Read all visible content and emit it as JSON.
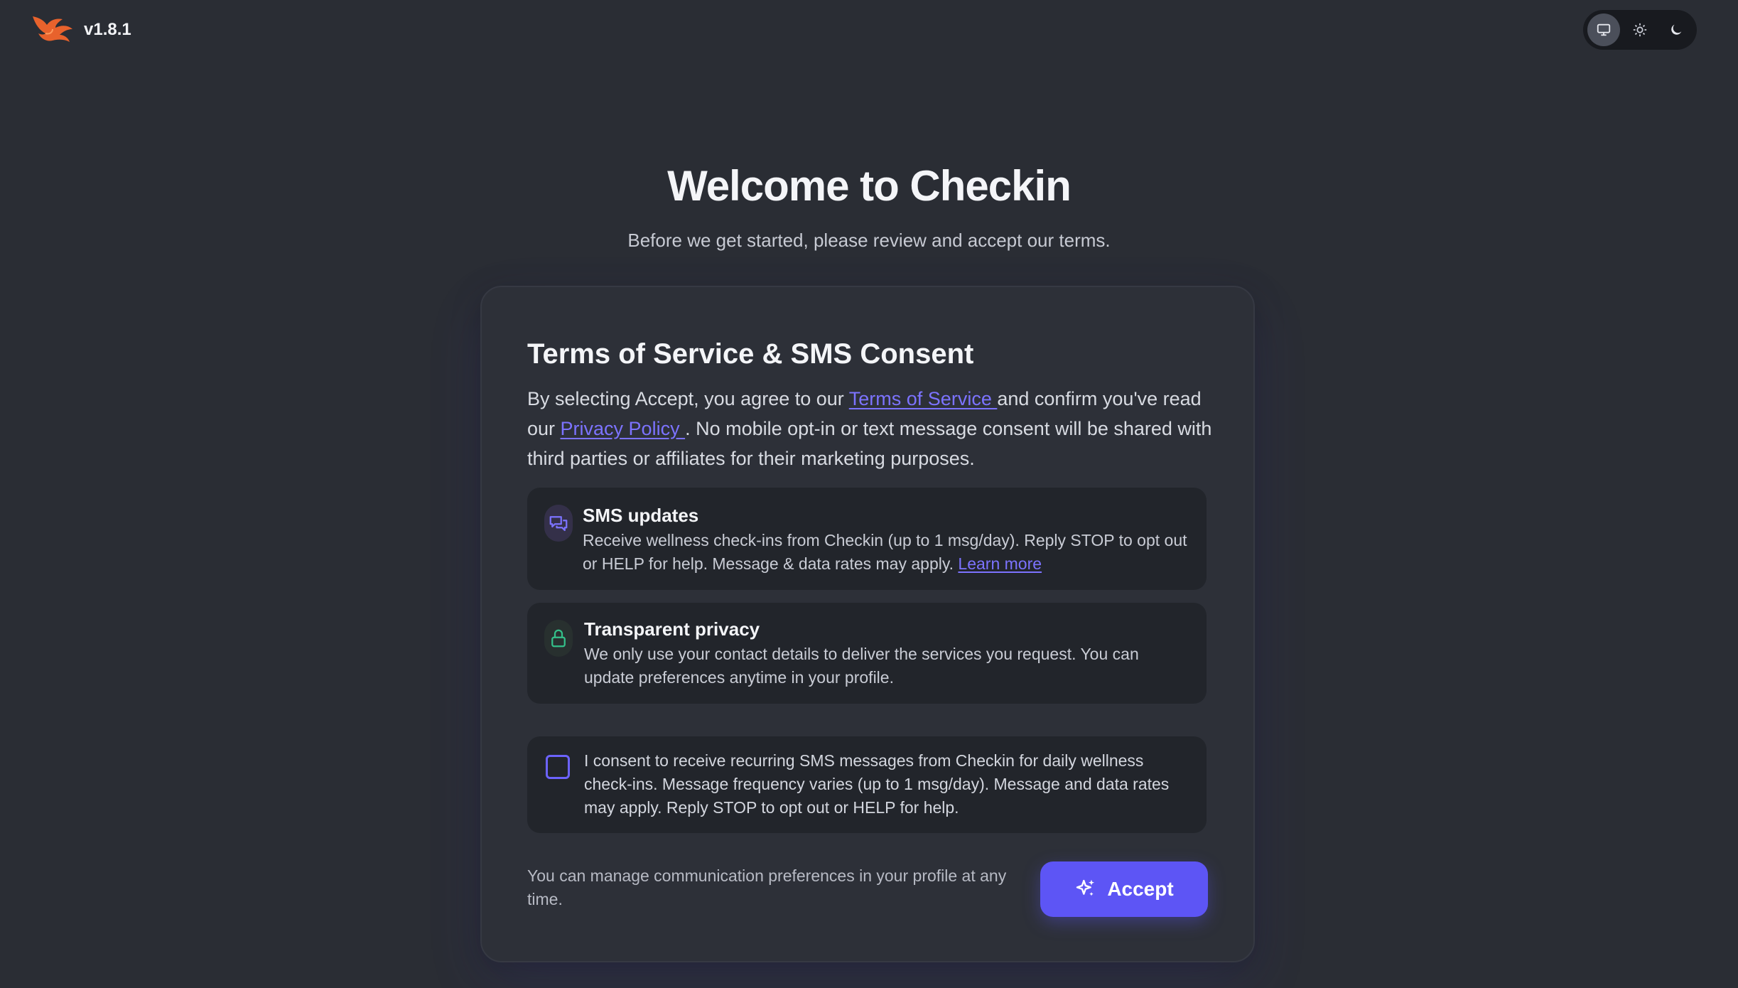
{
  "header": {
    "version": "v1.8.1",
    "theme_options": [
      {
        "name": "system",
        "icon": "monitor-icon",
        "active": true
      },
      {
        "name": "light",
        "icon": "sun-icon",
        "active": false
      },
      {
        "name": "dark",
        "icon": "moon-icon",
        "active": false
      }
    ]
  },
  "hero": {
    "title": "Welcome to Checkin",
    "subtitle": "Before we get started, please review and accept our terms."
  },
  "card": {
    "title": "Terms of Service & SMS Consent",
    "intro": {
      "before_tos": "By selecting Accept, you agree to our ",
      "tos_link": "Terms of Service ",
      "between": "and confirm you've read our ",
      "privacy_link": "Privacy Policy ",
      "after": ". No mobile opt-in or text message consent will be shared with third parties or affiliates for their marketing purposes."
    },
    "sms_updates": {
      "icon": "chat-bubbles-icon",
      "title": "SMS updates",
      "body": "Receive wellness check-ins from Checkin (up to 1 msg/day). Reply STOP to opt out or HELP for help. Message & data rates may apply. ",
      "link": "Learn more"
    },
    "privacy": {
      "icon": "lock-icon",
      "title": "Transparent privacy",
      "body": "We only use your contact details to deliver the services you request. You can update preferences anytime in your profile."
    },
    "consent": {
      "checked": false,
      "text": "I consent to receive recurring SMS messages from Checkin for daily wellness check-ins. Message frequency varies (up to 1 msg/day). Message and data rates may apply. Reply STOP to opt out or HELP for help."
    },
    "footer_note": "You can manage communication preferences in your profile at any time.",
    "accept_label": "Accept",
    "accept_icon": "sparkles-icon"
  },
  "colors": {
    "background": "#2a2d34",
    "card": "#2d3038",
    "accent": "#5d55f5",
    "link": "#7c73ff",
    "logo": "#e8622c"
  }
}
